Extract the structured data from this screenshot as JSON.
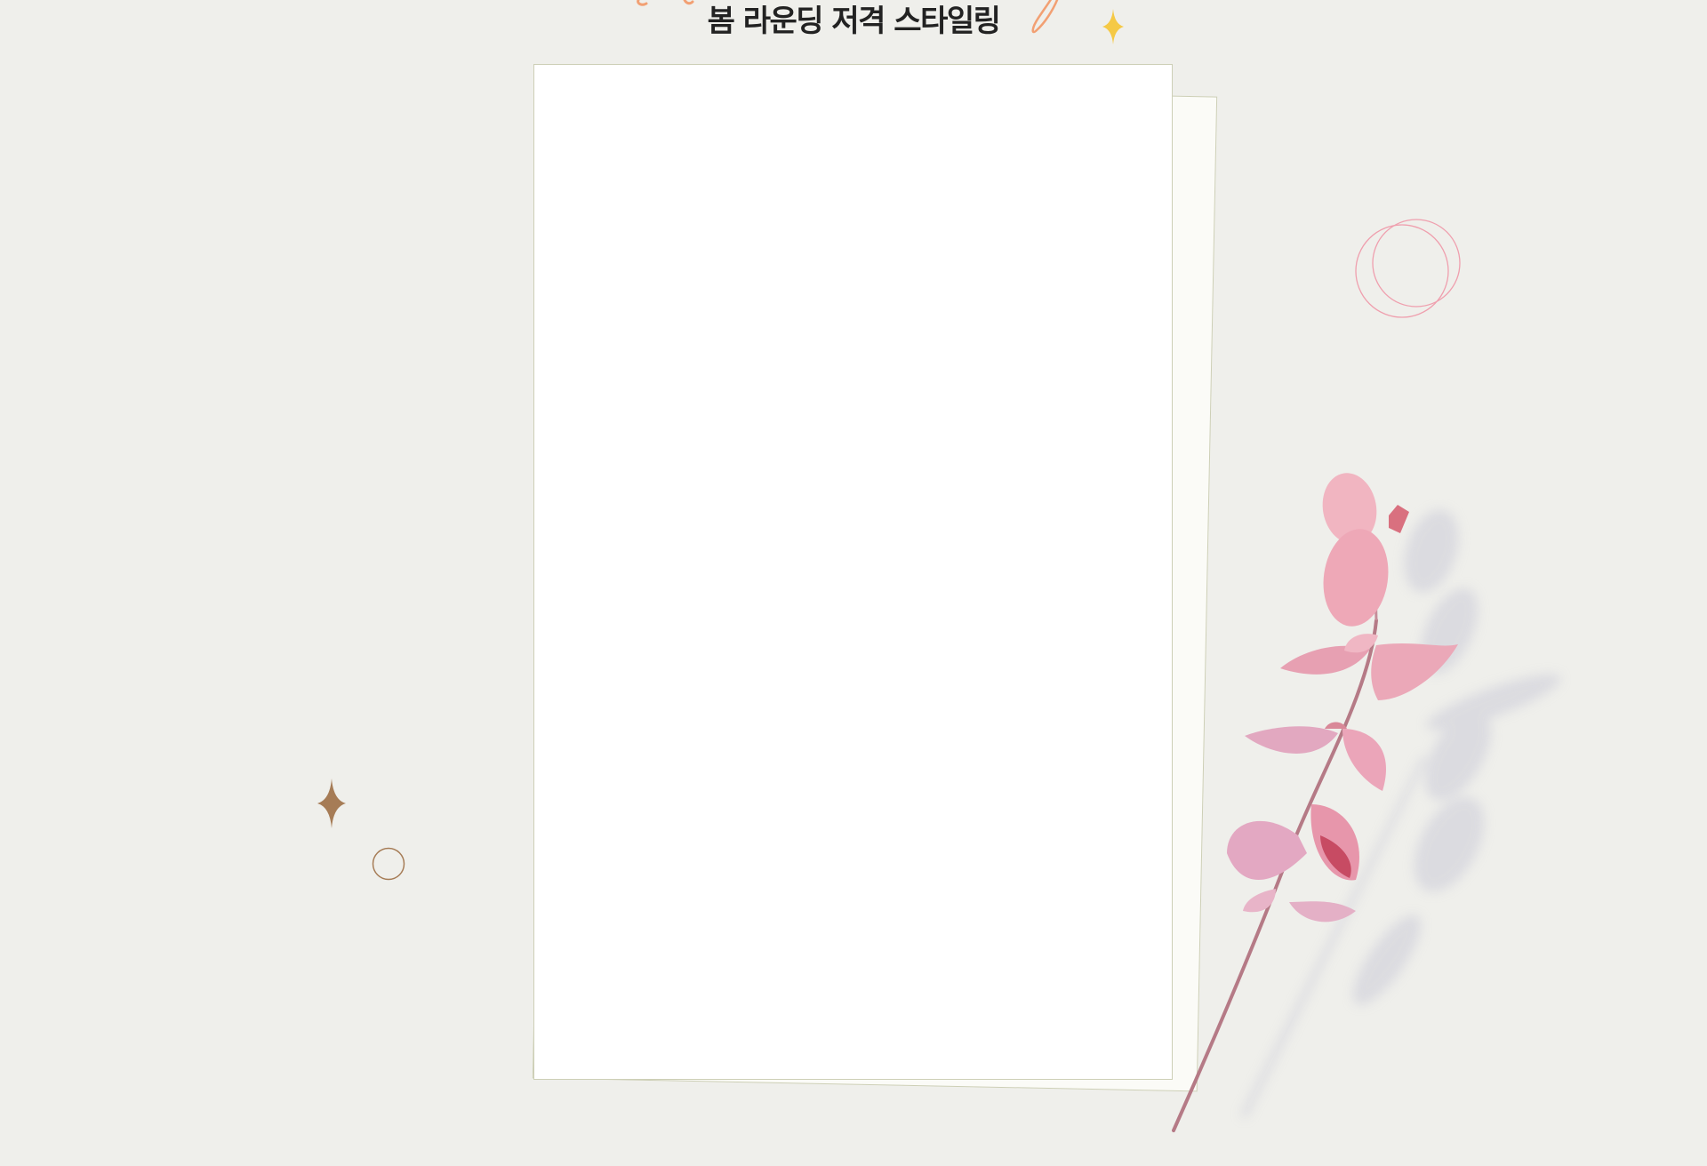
{
  "header": {
    "subtitle": "봄 라운딩 저격 스타일링"
  },
  "colors": {
    "background": "#efefeb",
    "sheet_border": "#cdcfb6",
    "script_orange": "#f2a073",
    "sparkle_yellow": "#f5c945",
    "sparkle_brown": "#a67c56",
    "ring_pink": "#ef9fae",
    "leaf_pink": "#e9a6b6"
  },
  "decorations": {
    "sparkle_icon_top": "four-point-star-icon",
    "sparkle_icon_left": "four-point-star-icon",
    "ring_icon_left": "circle-outline-icon",
    "rings_icon_right": "double-circle-outline-icon",
    "branch_image": "eucalyptus-branch-icon"
  }
}
